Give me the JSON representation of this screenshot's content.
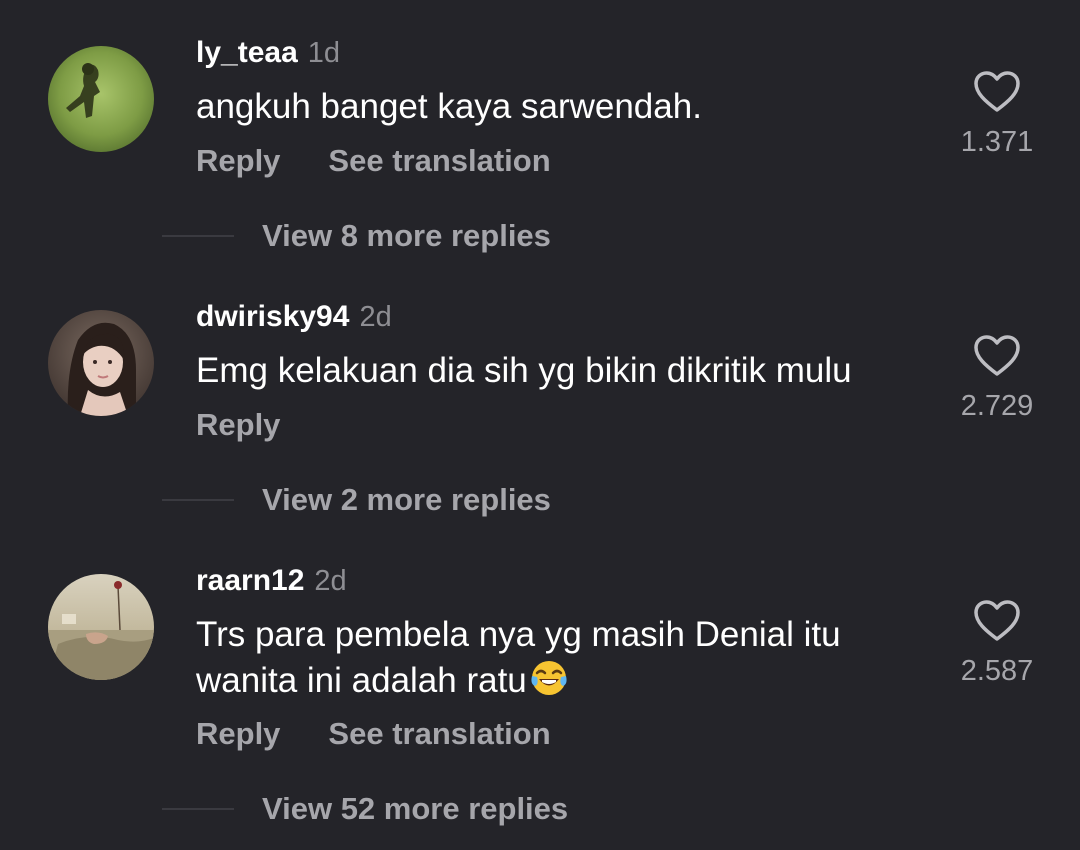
{
  "comments": [
    {
      "username": "ly_teaa",
      "time": "1d",
      "text": "angkuh banget kaya sarwendah.",
      "reply_label": "Reply",
      "translate_label": "See translation",
      "likes": "1.371",
      "view_replies": "View 8 more replies",
      "avatar_icon": "avatar-silhouette-grass"
    },
    {
      "username": "dwirisky94",
      "time": "2d",
      "text": "Emg kelakuan dia sih yg bikin dikritik mulu",
      "reply_label": "Reply",
      "likes": "2.729",
      "view_replies": "View 2 more replies",
      "avatar_icon": "avatar-portrait"
    },
    {
      "username": "raarn12",
      "time": "2d",
      "text_line1": "Trs para pembela nya yg masih Denial itu",
      "text_line2": "wanita ini adalah ratu",
      "emoji": "😂",
      "reply_label": "Reply",
      "translate_label": "See translation",
      "likes": "2.587",
      "view_replies": "View 52 more replies",
      "avatar_icon": "avatar-bed-rose"
    }
  ],
  "colors": {
    "background": "#242429",
    "primary_text": "#ffffff",
    "secondary_text": "#a6a6ab",
    "time_text": "#8e8e93"
  },
  "icons": {
    "like": "heart-outline-icon",
    "emoji": "tears-of-joy-emoji"
  }
}
